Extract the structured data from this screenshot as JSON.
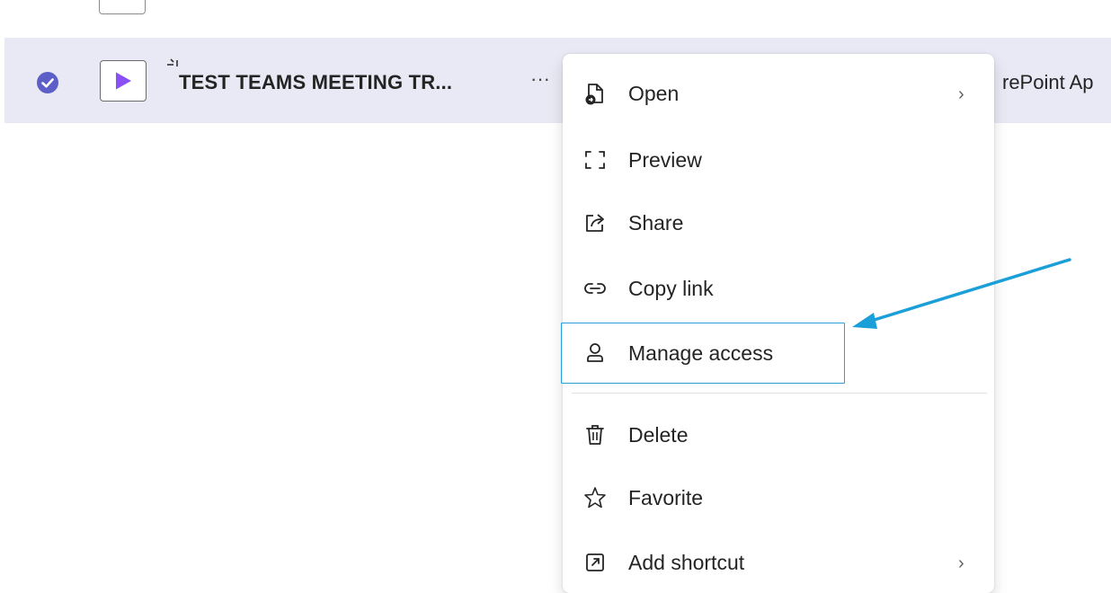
{
  "file_row": {
    "name": "TEST TEAMS MEETING TR...",
    "more_label": "···",
    "column_text": "rePoint Ap",
    "selected": true
  },
  "context_menu": {
    "items": [
      {
        "label": "Open",
        "icon": "open-document-icon",
        "has_submenu": true
      },
      {
        "label": "Preview",
        "icon": "preview-frame-icon",
        "has_submenu": false
      },
      {
        "label": "Share",
        "icon": "share-icon",
        "has_submenu": false
      },
      {
        "label": "Copy link",
        "icon": "link-icon",
        "has_submenu": false
      },
      {
        "label": "Manage access",
        "icon": "person-icon",
        "has_submenu": false,
        "focused": true
      },
      {
        "label": "Delete",
        "icon": "trash-icon",
        "has_submenu": false
      },
      {
        "label": "Favorite",
        "icon": "star-icon",
        "has_submenu": false
      },
      {
        "label": "Add shortcut",
        "icon": "shortcut-icon",
        "has_submenu": true
      }
    ],
    "chevron": "›"
  },
  "colors": {
    "selected_row_bg": "#e8e9f4",
    "check_accent": "#5b5fc7",
    "video_play": "#8a4ff5",
    "focus_ring": "#2b9fd8",
    "annotation_arrow": "#1a9fd9"
  }
}
